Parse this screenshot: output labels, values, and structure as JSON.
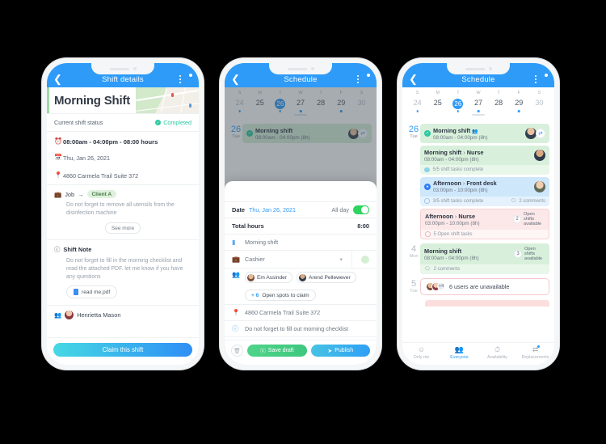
{
  "phone1": {
    "nav": {
      "back_icon": "chevron-left-icon",
      "title": "Shift details",
      "menu_icon": "list-menu-icon"
    },
    "hero_title": "Morning Shift",
    "status_label": "Current shift status",
    "status_value": "Completed",
    "time_row": "08:00am - 04:00pm - 08:00 hours",
    "date_row": "Thu, Jan 26, 2021",
    "address_row": "4860 Carmela Trail Suite 372",
    "job_label": "Job",
    "job_arrow": "→",
    "client_chip": "Client A",
    "job_desc": "Do not forget to remove all utensils from the disinfection machine",
    "see_more": "See more",
    "note_title": "Shift Note",
    "note_body": "Do not forget to fill in the morning checklist and read the attached PDF. let me know if you have any questions",
    "attachment": "read me.pdf",
    "worker_name": "Henrietta Mason",
    "cta": "Claim this shift"
  },
  "phone2": {
    "nav": {
      "title": "Schedule"
    },
    "calendar": {
      "weekdays": [
        "S",
        "M",
        "T",
        "W",
        "T",
        "F",
        "S"
      ],
      "dates": [
        {
          "n": "24",
          "dim": true,
          "dot": true,
          "sel": false
        },
        {
          "n": "25",
          "dim": false,
          "dot": false,
          "sel": false
        },
        {
          "n": "26",
          "dim": false,
          "dot": true,
          "sel": true
        },
        {
          "n": "27",
          "dim": false,
          "dot": true,
          "sel": false
        },
        {
          "n": "28",
          "dim": false,
          "dot": false,
          "sel": false
        },
        {
          "n": "29",
          "dim": false,
          "dot": true,
          "sel": false
        },
        {
          "n": "30",
          "dim": true,
          "dot": false,
          "sel": false
        }
      ]
    },
    "bg_day": {
      "num": "26",
      "weekday": "Tue"
    },
    "bg_card": {
      "title": "Morning shift",
      "time": "08:00am - 04:00pm (8h)"
    },
    "sheet": {
      "date_label": "Date",
      "date_value": "Thu, Jan 26, 2021",
      "allday_label": "All day",
      "allday_on": true,
      "total_hours_label": "Total hours",
      "total_hours_value": "8:00",
      "shift_name": "Morning shift",
      "role_name": "Cashier",
      "people": [
        "Em Assinder",
        "Arend Pellewever"
      ],
      "open_spots_prefix": "+ 6",
      "open_spots_label": "Open spots to claim",
      "address": "4860 Carmela Trail Suite 372",
      "checklist_note": "Do not forget to fill out morning checklist",
      "delete_icon": "trash-icon",
      "save_draft": "Save draft",
      "publish": "Publish"
    }
  },
  "phone3": {
    "nav": {
      "title": "Schedule"
    },
    "calendar": {
      "weekdays": [
        "S",
        "M",
        "T",
        "W",
        "T",
        "F",
        "S"
      ],
      "dates": [
        {
          "n": "24",
          "dim": true,
          "dot": true,
          "sel": false
        },
        {
          "n": "25",
          "dim": false,
          "dot": false,
          "sel": false
        },
        {
          "n": "26",
          "dim": false,
          "dot": true,
          "sel": true
        },
        {
          "n": "27",
          "dim": false,
          "dot": true,
          "sel": false
        },
        {
          "n": "28",
          "dim": false,
          "dot": false,
          "sel": false
        },
        {
          "n": "29",
          "dim": false,
          "dot": true,
          "sel": false
        },
        {
          "n": "30",
          "dim": true,
          "dot": false,
          "sel": false
        }
      ]
    },
    "days": [
      {
        "num": "26",
        "weekday": "Tue",
        "active": true,
        "cards": [
          {
            "color": "green",
            "status": "green",
            "title": "Morning shift",
            "role": "",
            "time": "08:00am - 04:00pm (8h)",
            "has_group_icon": true,
            "avatar": "a4",
            "swap": true,
            "foot": null
          },
          {
            "color": "green",
            "status": "",
            "title": "Morning shift",
            "role": "Nurse",
            "time": "08:00am - 04:00pm (8h)",
            "avatar": "a2",
            "foot": {
              "text": "5/5 shift tasks complete",
              "ring": "done"
            }
          },
          {
            "color": "blue",
            "status": "blue",
            "title": "Afternoon",
            "role": "Front desk",
            "time": "03:00pm - 10:00pm (8h)",
            "avatar": "a3",
            "foot": {
              "text": "3/5 shift tasks complete",
              "ring": "open",
              "comments": "2 comments"
            }
          },
          {
            "color": "pink",
            "status": "",
            "title": "Afternoon",
            "role": "Nurse",
            "time": "03:00pm - 10:00pm (8h)",
            "open_num": "2",
            "open_label": "Open shifts available",
            "foot": {
              "text": "5 Open shift tasks",
              "ring": "pink"
            }
          }
        ]
      },
      {
        "num": "4",
        "weekday": "Mon",
        "active": false,
        "cards": [
          {
            "color": "green",
            "status": "",
            "title": "Morning shift",
            "role": "",
            "time": "08:00am - 04:00pm (8h)",
            "open_num": "3",
            "open_label": "Open shifts available",
            "foot": {
              "text": "2 comments",
              "ring": "none",
              "comment_icon": true
            }
          }
        ]
      },
      {
        "num": "5",
        "weekday": "Tue",
        "active": false,
        "unavailable": {
          "plus": "+4",
          "text": "6 users are unavailable"
        }
      }
    ],
    "tabs": [
      {
        "label": "Only me",
        "icon": "person-icon",
        "active": false,
        "badge": false
      },
      {
        "label": "Everyone",
        "icon": "people-icon",
        "active": true,
        "badge": false
      },
      {
        "label": "Availability",
        "icon": "clock-icon",
        "active": false,
        "badge": false
      },
      {
        "label": "Replacements",
        "icon": "swap-icon",
        "active": false,
        "badge": true
      }
    ]
  },
  "colors": {
    "brand_blue": "#2e9bf8",
    "green_card": "#d8f0db",
    "blue_card": "#cfe7fb",
    "pink_card": "#fce8e8",
    "success": "#2ec9a0",
    "toggle_green": "#2fd35f"
  }
}
